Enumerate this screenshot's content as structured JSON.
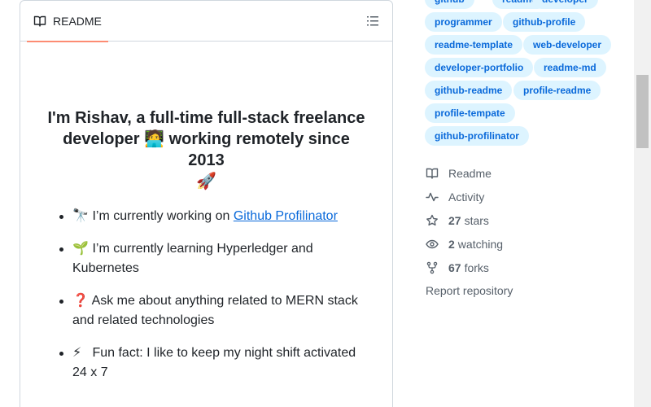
{
  "readme": {
    "tab_label": "README",
    "title": "I'm Rishav, a full-time full-stack freelance developer",
    "title_emoji_dev": "🧑‍💻",
    "title_line2": "working remotely since 2013",
    "title_emoji_rocket": "🚀",
    "items": [
      {
        "emoji": "🔭",
        "text": "I’m currently working on ",
        "link": "Github Profilinator"
      },
      {
        "emoji": "🌱",
        "text": "I’m currently learning Hyperledger and Kubernetes"
      },
      {
        "emoji": "❓",
        "text": "Ask me about anything related to MERN stack and related technologies"
      },
      {
        "emoji": "⚡",
        "text": "Fun fact: I like to keep my night shift activated 24 x 7"
      }
    ]
  },
  "topics": [
    "github",
    "readme",
    "developer",
    "programmer",
    "github-profile",
    "readme-template",
    "web-developer",
    "developer-portfolio",
    "readme-md",
    "github-readme",
    "profile-readme",
    "profile-tempate",
    "github-profilinator"
  ],
  "meta": {
    "readme_label": "Readme",
    "activity_label": "Activity",
    "stars_count": "27",
    "stars_label": "stars",
    "watching_count": "2",
    "watching_label": "watching",
    "forks_count": "67",
    "forks_label": "forks",
    "report_label": "Report repository"
  },
  "colors": {
    "link": "#0969da",
    "topic_bg": "#ddf4ff",
    "tab_underline": "#fd8c73",
    "muted": "#57606a"
  },
  "icons": [
    "book-icon",
    "list-icon",
    "pulse-icon",
    "star-icon",
    "eye-icon",
    "fork-icon"
  ]
}
